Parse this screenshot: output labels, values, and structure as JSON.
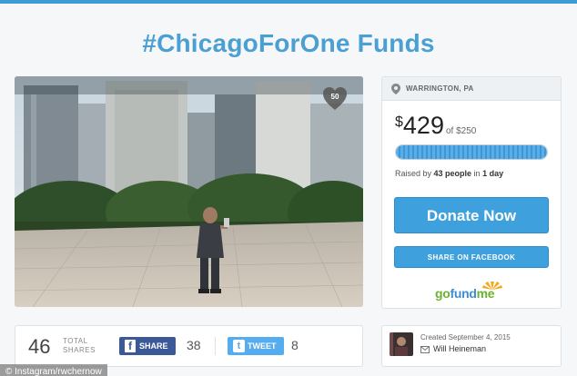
{
  "page_title": "#ChicagoForOne Funds",
  "photo": {
    "heart_count": "50",
    "heart_icon": "heart-icon"
  },
  "campaign": {
    "location": "WARRINGTON, PA",
    "currency": "$",
    "amount": "429",
    "goal": "of $250",
    "progress_fraction": 1.0,
    "raised_prefix": "Raised by ",
    "raised_people": "43 people",
    "raised_mid": " in ",
    "raised_days": "1 day",
    "donate_label": "Donate Now",
    "share_facebook_label": "SHARE ON FACEBOOK",
    "logo": {
      "go": "go",
      "fund": "fund",
      "me": "me"
    }
  },
  "share_bar": {
    "total_count": "46",
    "total_label_1": "TOTAL",
    "total_label_2": "SHARES",
    "facebook_label": "SHARE",
    "facebook_count": "38",
    "twitter_label": "TWEET",
    "twitter_count": "8"
  },
  "creator": {
    "created_text": "Created September 4, 2015",
    "name": "Will Heineman"
  },
  "photo_credit": "© Instagram/rwchernow",
  "colors": {
    "accent": "#3fa0de",
    "title": "#4a9fd3",
    "facebook": "#3b5998",
    "twitter": "#55acee"
  }
}
